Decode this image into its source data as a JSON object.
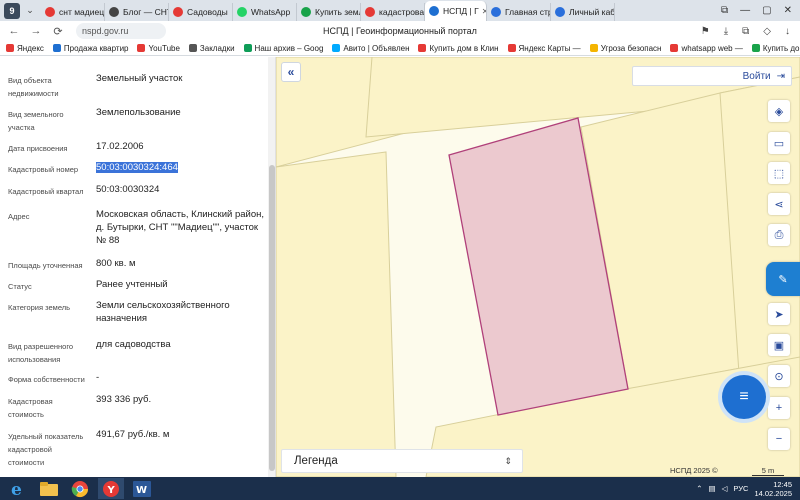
{
  "browser": {
    "tab_counter": "9",
    "tabs": [
      {
        "label": "снт мадиец",
        "favicon_color": "#e53935"
      },
      {
        "label": "Блог — СНТ",
        "favicon_color": "#444444"
      },
      {
        "label": "Садоводы",
        "favicon_color": "#e53935"
      },
      {
        "label": "WhatsApp",
        "favicon_color": "#25d366"
      },
      {
        "label": "Купить земл",
        "favicon_color": "#19a34a"
      },
      {
        "label": "кадастрова",
        "favicon_color": "#e53935"
      },
      {
        "label": "НСПД | Г",
        "favicon_color": "#1e6fd1",
        "active": true
      },
      {
        "label": "Главная стр",
        "favicon_color": "#2a6fdb"
      },
      {
        "label": "Личный каб",
        "favicon_color": "#2a6fdb"
      }
    ],
    "url": "nspd.gov.ru",
    "page_title": "НСПД | Геоинформационный портал",
    "bookmarks": [
      {
        "label": "Яндекс",
        "color": "#e53935"
      },
      {
        "label": "Продажа квартир",
        "color": "#1e6fd1"
      },
      {
        "label": "YouTube",
        "color": "#e53935"
      },
      {
        "label": "Закладки",
        "color": "#555555"
      },
      {
        "label": "Наш архив – Goog",
        "color": "#0f9d58"
      },
      {
        "label": "Авито | Объявлен",
        "color": "#00aaff"
      },
      {
        "label": "Купить дом в Клин",
        "color": "#e53935"
      },
      {
        "label": "Яндекс Карты —",
        "color": "#e53935"
      },
      {
        "label": "Угроза безопасн",
        "color": "#f4b400"
      },
      {
        "label": "whatsapp web —",
        "color": "#e53935"
      },
      {
        "label": "Купить дом, дачу",
        "color": "#19a34a"
      }
    ]
  },
  "properties": [
    {
      "label": "Вид объекта недвижимости",
      "value": "Земельный участок"
    },
    {
      "label": "Вид земельного участка",
      "value": "Землепользование"
    },
    {
      "label": "Дата присвоения",
      "value": "17.02.2006"
    },
    {
      "label": "Кадастровый номер",
      "value": "50:03:0030324:464",
      "selected": true
    },
    {
      "label": "Кадастровый квартал",
      "value": "50:03:0030324"
    },
    {
      "label": "Адрес",
      "value": "Московская область, Клинский район, д. Бутырки, СНТ \"\"Мадиец\"\", участок № 88"
    },
    {
      "label": "Площадь уточненная",
      "value": "800 кв. м"
    },
    {
      "label": "Статус",
      "value": "Ранее учтенный"
    },
    {
      "label": "Категория земель",
      "value": "Земли сельскохозяйственного назначения"
    },
    {
      "label": "Вид разрешенного использования",
      "value": "для садоводства"
    },
    {
      "label": "Форма собственности",
      "value": "-"
    },
    {
      "label": "Кадастровая стоимость",
      "value": "393 336 руб."
    },
    {
      "label": "Удельный показатель кадастровой стоимости",
      "value": "491,67 руб./кв. м"
    }
  ],
  "map": {
    "login_label": "Войти",
    "legend_label": "Легенда",
    "attribution": "НСПД 2025 ©",
    "scale_label": "5 m",
    "colors": {
      "parcel_fill": "#ecc9cf",
      "parcel_stroke": "#b0407a",
      "background": "#fdfbec",
      "plot_fill": "#fbf3c8",
      "plot_stroke": "#d8cf9a"
    }
  },
  "taskbar": {
    "language": "РУС",
    "time": "12:45",
    "date": "14.02.2025"
  }
}
